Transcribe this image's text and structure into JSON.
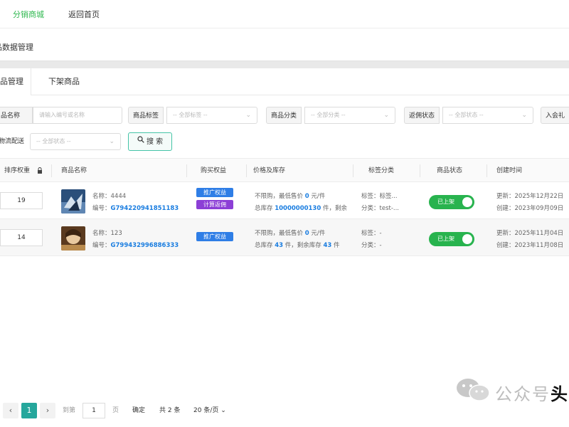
{
  "topnav": {
    "items": [
      "分销商城",
      "返回首页"
    ]
  },
  "subtitle": "品数据管理",
  "tabs": [
    "品管理",
    "下架商品"
  ],
  "filters": {
    "name_label": "品名称",
    "name_placeholder": "请输入编号或名称",
    "tag_label": "商品标签",
    "tag_placeholder": "-- 全部标签 --",
    "category_label": "商品分类",
    "category_placeholder": "-- 全部分类 --",
    "rebate_label": "返佣状态",
    "rebate_placeholder": "-- 全部状态 --",
    "join_label": "入会礼",
    "logistics_label": "物流配送",
    "logistics_placeholder": "-- 全部状态 --",
    "search_label": "搜 索"
  },
  "table": {
    "headers": [
      "排序权重",
      "商品名称",
      "购买权益",
      "价格及库存",
      "标签分类",
      "商品状态",
      "创建时间"
    ],
    "rows": [
      {
        "sort": "19",
        "name_prefix": "名称：",
        "name": "4444",
        "code_prefix": "编号：",
        "code": "G794220941851183",
        "badges": [
          "推广权益",
          "计算返佣"
        ],
        "price_text_a": "不限购，最低售价 ",
        "price_value": "0",
        "price_text_b": " 元/件",
        "stock_text_a": "总库存 ",
        "stock_value": "10000000130",
        "stock_text_b": " 件，剩余",
        "tag_line": "标签：标签...",
        "cat_line": "分类：test-...",
        "status": "已上架",
        "updated": "更新：2025年12月22日",
        "created": "创建：2023年09月09日"
      },
      {
        "sort": "14",
        "name_prefix": "名称：",
        "name": "123",
        "code_prefix": "编号：",
        "code": "G799432996886333",
        "badges": [
          "推广权益"
        ],
        "price_text_a": "不限购，最低售价 ",
        "price_value": "0",
        "price_text_b": " 元/件",
        "stock_text_a": "总库存 ",
        "stock_value": "43",
        "stock_text_b": " 件，剩余库存 ",
        "stock_remaining": "43",
        "stock_text_c": " 件",
        "tag_line": "标签：-",
        "cat_line": "分类：-",
        "status": "已上架",
        "updated": "更新：2025年11月04日",
        "created": "创建：2023年11月08日"
      }
    ]
  },
  "pagination": {
    "prev": "‹",
    "current": "1",
    "next": "›",
    "goto_label": "到第",
    "goto_value": "1",
    "page_unit": "页",
    "confirm": "确定",
    "total": "共 2 条",
    "page_size": "20 条/页"
  },
  "watermark": {
    "text_a": "公众号",
    "text_b": "头"
  },
  "colors": {
    "accent_green": "#2fb84f",
    "link_blue": "#1a7de0",
    "badge_blue": "#2f7ee6",
    "badge_purple": "#8c3fd6",
    "toggle_green": "#28b34e",
    "pager_active": "#25a79c"
  }
}
